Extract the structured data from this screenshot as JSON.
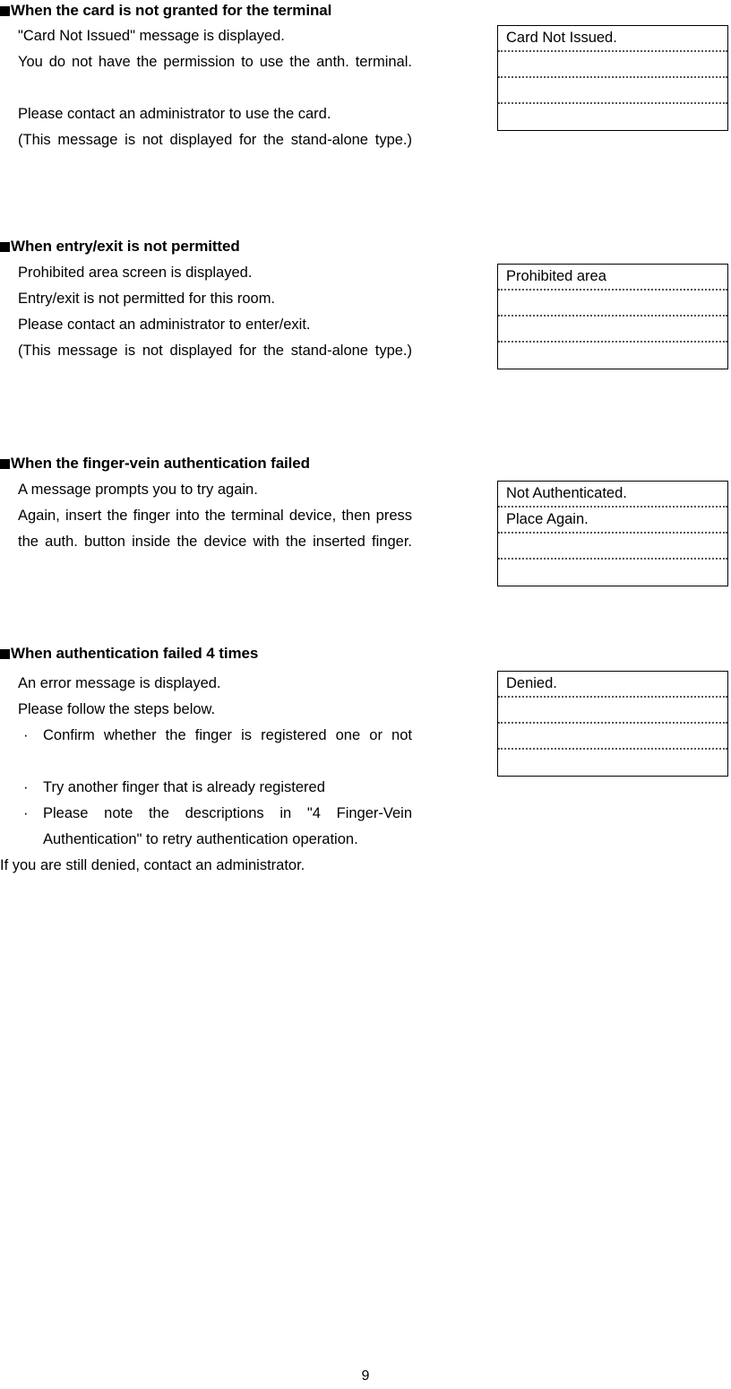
{
  "page": {
    "number": "9"
  },
  "sections": [
    {
      "heading": "When the card is not granted for the terminal",
      "lines": [
        "\"Card Not Issued\" message is displayed.",
        "You do not have the permission to use the anth. terminal.",
        "Please contact an administrator to use the card.",
        "(This message is not displayed for the stand-alone type.)"
      ],
      "screen": {
        "rows": [
          "Card Not Issued.",
          "",
          "",
          ""
        ]
      }
    },
    {
      "heading": "When entry/exit is not permitted",
      "lines": [
        "Prohibited area screen is displayed.",
        "Entry/exit is not permitted for this room.",
        "Please contact an administrator to enter/exit.",
        "(This message is not displayed for the stand-alone type.)"
      ],
      "screen": {
        "rows": [
          "Prohibited area",
          "",
          "",
          ""
        ]
      }
    },
    {
      "heading": "When the finger-vein authentication failed",
      "lines": [
        "A message prompts you to try again.",
        "Again, insert the finger into the terminal device, then press the auth. button inside the device with the inserted finger."
      ],
      "screen": {
        "rows": [
          "Not Authenticated.",
          "Place Again.",
          "",
          ""
        ]
      }
    },
    {
      "heading": "When authentication failed 4 times",
      "lines": [
        "An error message is displayed.",
        "Please follow the steps below."
      ],
      "bullets": [
        "Confirm whether the finger is registered one or not",
        "Try another finger that is already registered",
        "Please note the descriptions in \"4 Finger-Vein Authentication\" to retry authentication operation."
      ],
      "closing": "If you are still denied, contact an administrator.",
      "screen": {
        "rows": [
          "Denied.",
          "",
          "",
          ""
        ]
      }
    }
  ]
}
